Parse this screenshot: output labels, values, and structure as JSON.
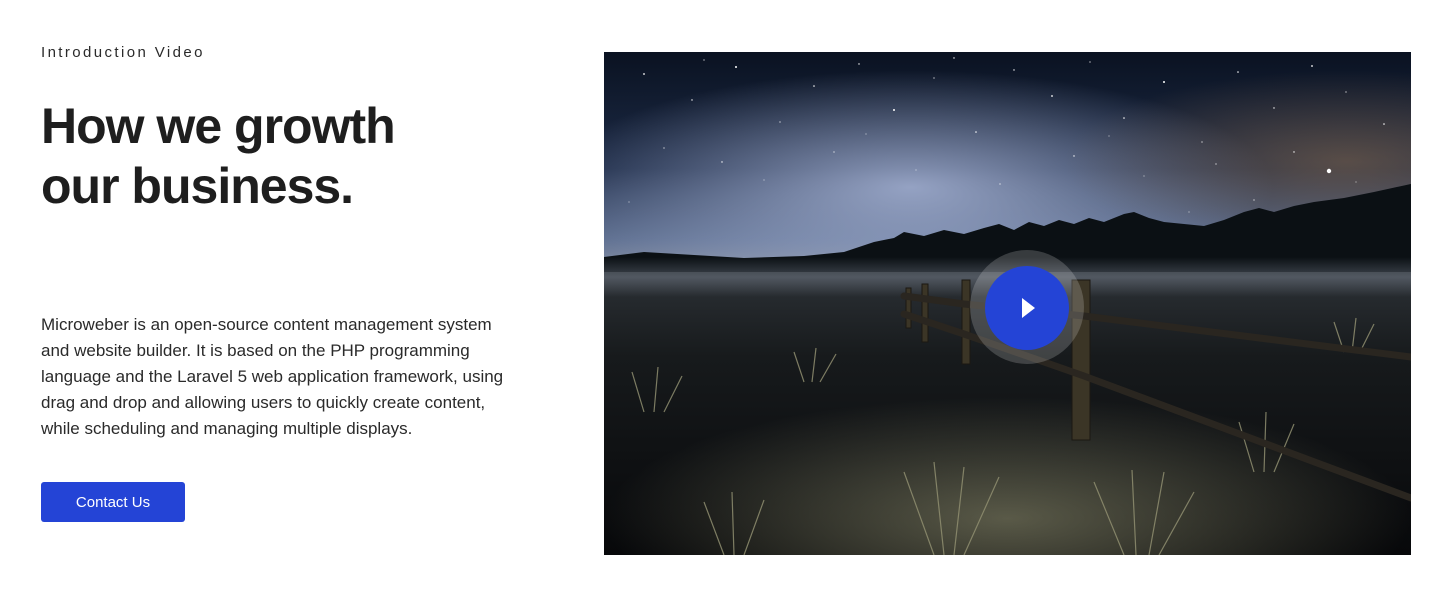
{
  "intro": {
    "eyebrow": "Introduction Video",
    "headline_line1": "How we growth",
    "headline_line2": "our business.",
    "description": "Microweber is an open-source content management system and website builder. It is based on the PHP programming language and the Laravel 5 web application framework, using drag and drop and allowing users to quickly create content, while scheduling and managing multiple displays.",
    "cta_label": "Contact Us"
  },
  "video": {
    "thumbnail_subject": "starry night sky over a grassy field with a wooden fence",
    "play_icon": "play-icon"
  },
  "colors": {
    "accent": "#2444d6",
    "text_dark": "#1e1e1e",
    "background": "#ffffff"
  }
}
